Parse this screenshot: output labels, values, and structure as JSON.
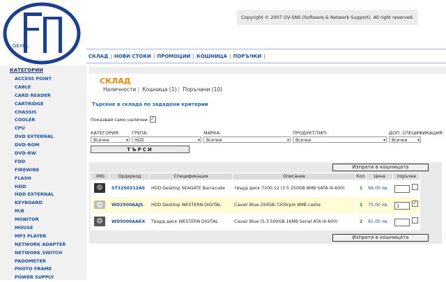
{
  "header": {
    "logo_text": "GEXEL",
    "copyright": "Copyright © 2007 GV-SNS (Software & Network Support). All right reserved."
  },
  "nav": [
    "СКЛАД",
    "НОВИ СТОКИ",
    "ПРОМОЦИИ",
    "КОШНИЦА",
    "ПОРЪЧКИ"
  ],
  "sidebar": {
    "heading": "КАТЕГОРИИ",
    "items": [
      "ACCESS POINT",
      "CABLE",
      "CARD READER",
      "CARTRIDGE",
      "CHASSIS",
      "COOLER",
      "CPU",
      "DVD EXTERNAL",
      "DVD-ROM",
      "DVD-RW",
      "FDD",
      "FIREWIRE",
      "FLASH",
      "HDD",
      "HDD EXTERNAL",
      "KEYBOARD",
      "M/B",
      "MONITOR",
      "MOUSE",
      "MP3 PLAYER",
      "NETWORK ADAPTER",
      "NETWORK SWITCH",
      "PADOMETER",
      "PHOTO FRAME",
      "POWER SUPPLY"
    ]
  },
  "main": {
    "title": "СКЛАД",
    "tabs": [
      "Наличности",
      "Кошница (1)",
      "Поръчани (10)"
    ],
    "search_link": "Търсене в склада по зададени критерии",
    "in_stock_label": "Показвай само налични",
    "filters": {
      "category": {
        "label": "КАТЕГОРИЯ:",
        "value": "Всички"
      },
      "group": {
        "label": "ГРУПА:",
        "value": "HDD"
      },
      "brand": {
        "label": "МАРКА:",
        "value": "Всички"
      },
      "product": {
        "label": "ПРОДУКТ/ТИП:",
        "value": "Всички"
      },
      "extra": {
        "label": "ДОП. СПЕЦИФИКАЦИЯ:",
        "value": "Всички"
      }
    },
    "search_button": "ТЪРСИ",
    "cart_button": "Изпрати в кошницата",
    "table": {
      "headers": [
        "IMG",
        "Ордеркод",
        "Спецификация",
        "Описание",
        "Кол.",
        "Цена",
        "поръчка"
      ],
      "rows": [
        {
          "code": "ST3250312AS",
          "spec": "HDD Desktop SEAGATE Barracuda",
          "desc": "твърд диск 7200.12 (3.5 250GB 8MB SATA III-600)",
          "qty": "1",
          "price": "68.00 лв.",
          "order": ""
        },
        {
          "code": "WD2500AAJS",
          "spec": "HDD Desktop WESTERN DIGITAL",
          "desc": "Cavair Blue 250GB 7200rpm 8MB cashe",
          "qty": "1",
          "price": "75.00 лв.",
          "order": "1"
        },
        {
          "code": "WD5000AAKX",
          "spec": "Твърд диск WESTERN DIGITAL",
          "desc": "Cavair Blue (5.3 500GB 16MB Serial ATA III-600)",
          "qty": "2",
          "price": "81.00 лв.",
          "order": ""
        }
      ]
    }
  }
}
